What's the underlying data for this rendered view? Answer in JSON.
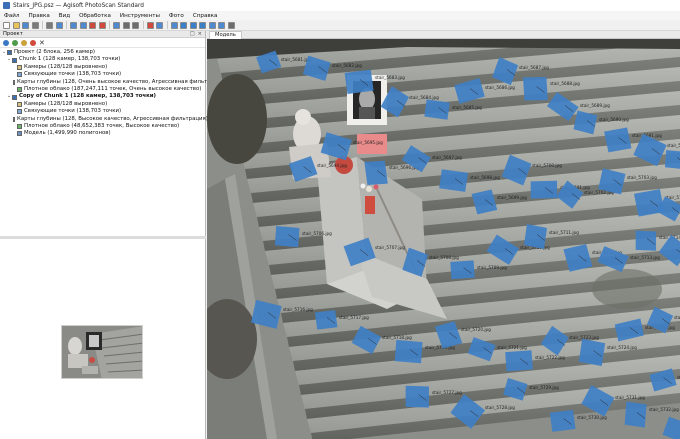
{
  "window": {
    "title": "Stairs_JPG.psz — Agisoft PhotoScan Standard"
  },
  "menu": {
    "items": [
      "Файл",
      "Правка",
      "Вид",
      "Обработка",
      "Инструменты",
      "Фото",
      "Справка"
    ]
  },
  "toolbar": {
    "icons": [
      "new-icon",
      "open-icon",
      "save-icon",
      "undo-icon",
      "redo-icon",
      "navigation-icon",
      "rect-select-icon",
      "circle-select-icon",
      "rotate-object-icon",
      "zoom-in-icon",
      "zoom-out-icon",
      "reset-view-icon",
      "crop-icon",
      "delete-icon",
      "point-cloud-icon",
      "dense-cloud-icon",
      "mesh-shaded-icon",
      "mesh-solid-icon",
      "texture-icon",
      "cameras-icon",
      "resize-region-icon",
      "axes-icon"
    ]
  },
  "project_panel": {
    "header": "Проект",
    "toolbar_icons": [
      "add-chunk-icon",
      "add-photos-icon",
      "align-icon",
      "disable-icon",
      "remove-icon"
    ],
    "tree": [
      {
        "label": "Проект (2 блока, 256 камер)",
        "level": 0
      },
      {
        "label": "Chunk 1 (128 камер, 138,703 точки)",
        "level": 1
      },
      {
        "label": "Камеры (128/128 выровнено)",
        "level": 2
      },
      {
        "label": "Связующие точки (138,703 точки)",
        "level": 2
      },
      {
        "label": "Карты глубины (128, Очень высокое качество, Агрессивная фильтрация)",
        "level": 2
      },
      {
        "label": "Плотное облако (187,247,111 точек, Очень высокое качество)",
        "level": 2
      },
      {
        "label": "Copy of Chunk 1 (128 камер, 138,703 точки)",
        "level": 1,
        "bold": true
      },
      {
        "label": "Камеры (128/128 выровнено)",
        "level": 2
      },
      {
        "label": "Связующие точки (138,703 точки)",
        "level": 2
      },
      {
        "label": "Карты глубины (128, Высокое качество, Агрессивная фильтрация)",
        "level": 2
      },
      {
        "label": "Плотное облако (48,652,383 точек, Высокое качество)",
        "level": 2
      },
      {
        "label": "Модель (1,499,990 полигонов)",
        "level": 2
      }
    ]
  },
  "view": {
    "tab_label": "Модель"
  },
  "cameras": [
    "stair_5681.jpg",
    "stair_5682.jpg",
    "stair_5683.jpg",
    "stair_5684.jpg",
    "stair_5685.jpg",
    "stair_5686.jpg",
    "stair_5687.jpg",
    "stair_5688.jpg",
    "stair_5689.jpg",
    "stair_5690.jpg",
    "stair_5691.jpg",
    "stair_5692.jpg",
    "stair_5693.jpg",
    "stair_5694.jpg",
    "stair_5695.jpg",
    "stair_5696.jpg",
    "stair_5697.jpg",
    "stair_5698.jpg",
    "stair_5699.jpg",
    "stair_5700.jpg",
    "stair_5701.jpg",
    "stair_5702.jpg",
    "stair_5703.jpg",
    "stair_5704.jpg",
    "stair_5705.jpg",
    "stair_5706.jpg",
    "stair_5707.jpg",
    "stair_5708.jpg",
    "stair_5709.jpg",
    "stair_5710.jpg",
    "stair_5711.jpg",
    "stair_5712.jpg",
    "stair_5713.jpg",
    "stair_5714.jpg",
    "stair_5715.jpg",
    "stair_5716.jpg",
    "stair_5717.jpg",
    "stair_5718.jpg",
    "stair_5719.jpg",
    "stair_5720.jpg",
    "stair_5721.jpg",
    "stair_5722.jpg",
    "stair_5723.jpg",
    "stair_5724.jpg",
    "stair_5725.jpg",
    "stair_5726.jpg",
    "stair_5727.jpg",
    "stair_5728.jpg",
    "stair_5729.jpg",
    "stair_5730.jpg",
    "stair_5731.jpg",
    "stair_5732.jpg",
    "stair_5733.jpg",
    "stair_5734.jpg"
  ],
  "colors": {
    "camera_plane": "#3f7fc6",
    "camera_label": "#1e1e1e",
    "stone": "#9a9c97",
    "shadow": "#5c5e5a",
    "selection": "#cfe3f7"
  }
}
